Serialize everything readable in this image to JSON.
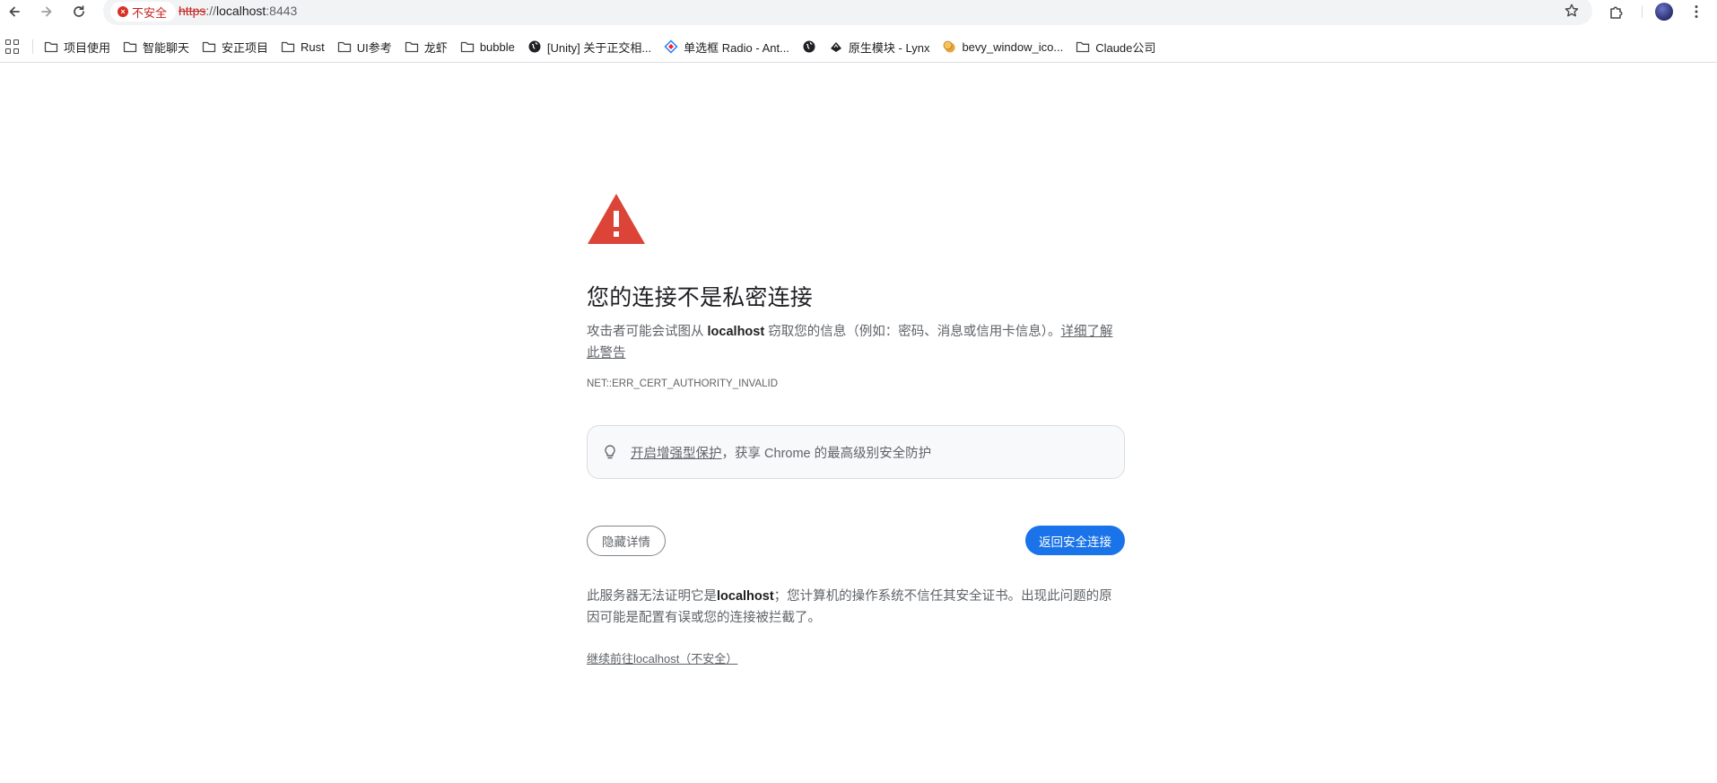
{
  "toolbar": {
    "security_label": "不安全",
    "url_protocol": "https",
    "url_separator": "://",
    "url_host": "localhost",
    "url_port": ":8443"
  },
  "bookmarks": [
    {
      "icon": "folder-icon",
      "label": "项目使用"
    },
    {
      "icon": "folder-icon",
      "label": "智能聊天"
    },
    {
      "icon": "folder-icon",
      "label": "安正项目"
    },
    {
      "icon": "folder-icon",
      "label": "Rust"
    },
    {
      "icon": "folder-icon",
      "label": "UI参考"
    },
    {
      "icon": "folder-icon",
      "label": "龙虾"
    },
    {
      "icon": "folder-icon",
      "label": "bubble"
    },
    {
      "icon": "globe-icon",
      "label": "[Unity] 关于正交相..."
    },
    {
      "icon": "antd-icon",
      "label": "单选框 Radio - Ant..."
    },
    {
      "icon": "globe-icon",
      "label": ""
    },
    {
      "icon": "lynx-icon",
      "label": "原生模块 - Lynx"
    },
    {
      "icon": "coin-icon",
      "label": "bevy_window_ico..."
    },
    {
      "icon": "folder-icon",
      "label": "Claude公司"
    }
  ],
  "interstitial": {
    "heading": "您的连接不是私密连接",
    "desc_prefix": "攻击者可能会试图从 ",
    "desc_host": "localhost",
    "desc_suffix": " 窃取您的信息（例如：密码、消息或信用卡信息）。",
    "learn_more": "详细了解此警告",
    "error_code": "NET::ERR_CERT_AUTHORITY_INVALID",
    "protection_link": "开启增强型保护",
    "protection_rest": "，获享 Chrome 的最高级别安全防护",
    "hide_details": "隐藏详情",
    "back_to_safety": "返回安全连接",
    "details_prefix": "此服务器无法证明它是",
    "details_host": "localhost",
    "details_suffix": "；您计算机的操作系统不信任其安全证书。出现此问题的原因可能是配置有误或您的连接被拦截了。",
    "proceed_link": "继续前往localhost（不安全）"
  },
  "colors": {
    "warning_red": "#db4437",
    "primary_blue": "#1a73e8",
    "text_secondary": "#5f6368"
  }
}
